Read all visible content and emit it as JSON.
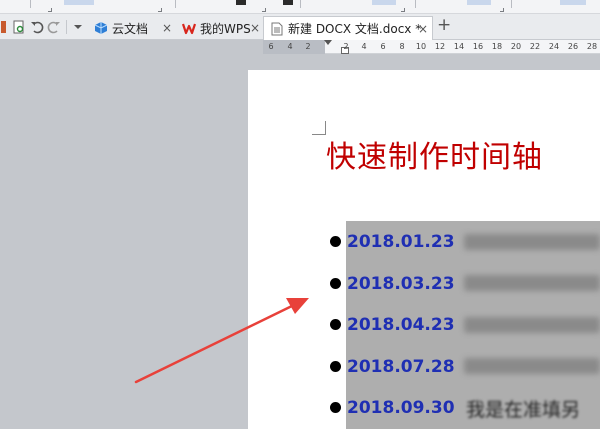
{
  "tabs": [
    {
      "label": "云文档",
      "icon": "cloud-doc-icon",
      "active": false
    },
    {
      "label": "我的WPS",
      "icon": "wps-logo-icon",
      "active": false
    },
    {
      "label": "新建 DOCX 文档.docx *",
      "icon": "document-icon",
      "active": true
    }
  ],
  "tab_close_glyph": "×",
  "tab_add_glyph": "+",
  "ruler_numbers": [
    "6",
    "4",
    "2",
    "2",
    "4",
    "6",
    "8",
    "10",
    "12",
    "14",
    "16",
    "18",
    "20",
    "22",
    "24",
    "26",
    "28"
  ],
  "document": {
    "title": "快速制作时间轴",
    "items": [
      {
        "date": "2018.01.23"
      },
      {
        "date": "2018.03.23"
      },
      {
        "date": "2018.04.23"
      },
      {
        "date": "2018.07.28"
      },
      {
        "date": "2018.09.30",
        "visible_text": "我是在准填另"
      }
    ]
  },
  "colors": {
    "title_red": "#c00000",
    "date_blue": "#1f2fb3",
    "arrow_red": "#e8413a",
    "selection_gray": "#aeaeae"
  }
}
